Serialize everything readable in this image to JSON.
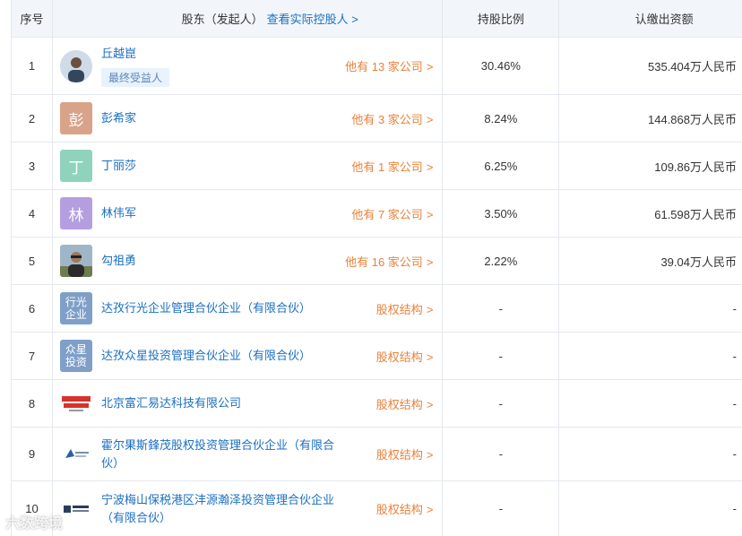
{
  "header": {
    "index": "序号",
    "holder": "股东（发起人）",
    "holder_link": "查看实际控股人 >",
    "ratio": "持股比例",
    "amount": "认缴出资额"
  },
  "rows": [
    {
      "index": "1",
      "name": "丘越崑",
      "badge": "最终受益人",
      "link": "他有 13 家公司",
      "ratio": "30.46%",
      "amount": "535.404万人民币",
      "avatar": "photo"
    },
    {
      "index": "2",
      "name": "彭希家",
      "link": "他有 3 家公司",
      "ratio": "8.24%",
      "amount": "144.868万人民币",
      "avatar_char": "彭",
      "avatar_color": "#d8a389"
    },
    {
      "index": "3",
      "name": "丁丽莎",
      "link": "他有 1 家公司",
      "ratio": "6.25%",
      "amount": "109.86万人民币",
      "avatar_char": "丁",
      "avatar_color": "#8fd3bd"
    },
    {
      "index": "4",
      "name": "林伟军",
      "link": "他有 7 家公司",
      "ratio": "3.50%",
      "amount": "61.598万人民币",
      "avatar_char": "林",
      "avatar_color": "#b49ee0"
    },
    {
      "index": "5",
      "name": "勾祖勇",
      "link": "他有 16 家公司",
      "ratio": "2.22%",
      "amount": "39.04万人民币",
      "avatar": "photo"
    },
    {
      "index": "6",
      "name": "达孜行光企业管理合伙企业（有限合伙）",
      "link": "股权结构",
      "ratio": "-",
      "amount": "-",
      "avatar_char": "行光企业",
      "avatar_color": "#7f9fc8"
    },
    {
      "index": "7",
      "name": "达孜众星投资管理合伙企业（有限合伙）",
      "link": "股权结构",
      "ratio": "-",
      "amount": "-",
      "avatar_char": "众星投资",
      "avatar_color": "#7f9fc8"
    },
    {
      "index": "8",
      "name": "北京富汇易达科技有限公司",
      "link": "股权结构",
      "ratio": "-",
      "amount": "-",
      "avatar": "logo-fuhui"
    },
    {
      "index": "9",
      "name": "霍尔果斯鋒茂股权投资管理合伙企业（有限合伙）",
      "link": "股权结构",
      "ratio": "-",
      "amount": "-",
      "avatar": "logo-fengmao"
    },
    {
      "index": "10",
      "name": "宁波梅山保税港区沣源瀚泽投资管理合伙企业（有限合伙）",
      "link": "股权结构",
      "ratio": "-",
      "amount": "-",
      "avatar": "logo-fengyuan"
    }
  ],
  "watermark": "六数跨境",
  "colors": {
    "link_blue": "#1a6fc2",
    "link_orange": "#e8813a",
    "header_bg": "#f2f6fb",
    "border": "#e4e8ee"
  }
}
